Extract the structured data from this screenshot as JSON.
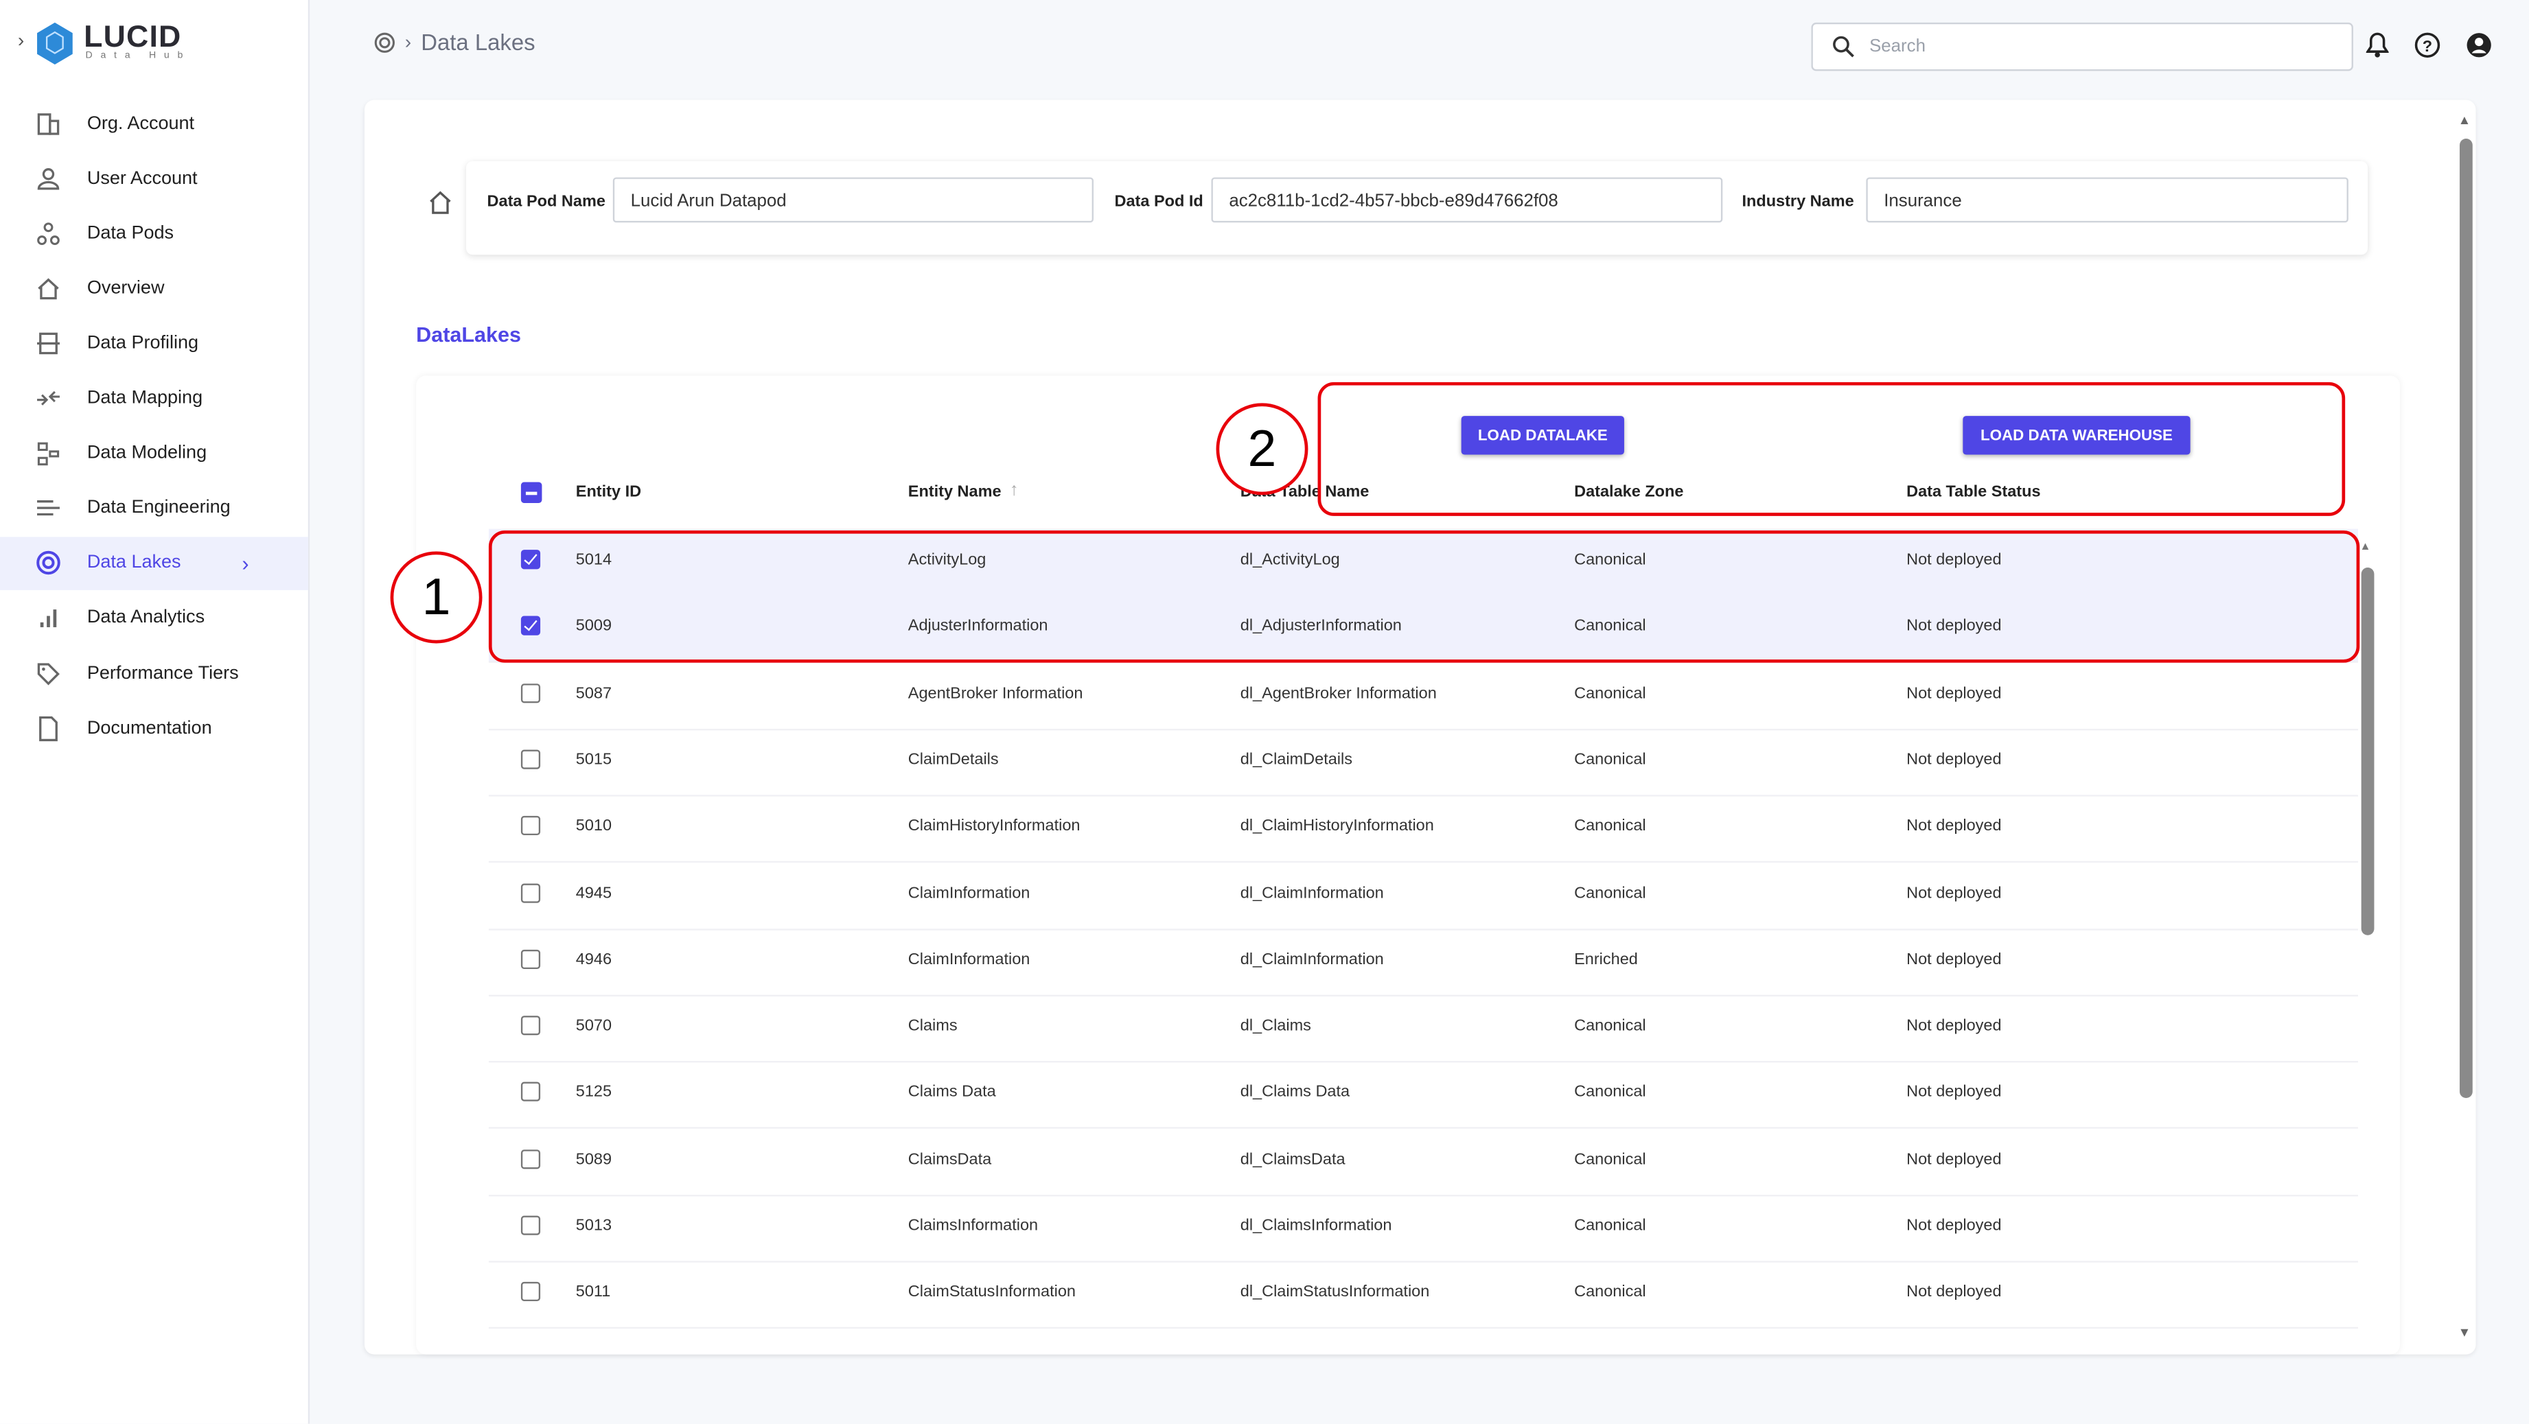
{
  "colors": {
    "accent": "#4f46e5",
    "annotation": "#e8000b"
  },
  "logo": {
    "name": "LUCID",
    "tagline": "Data Hub"
  },
  "sidebar": {
    "items": [
      {
        "label": "Org. Account",
        "icon": "building-icon"
      },
      {
        "label": "User Account",
        "icon": "user-icon"
      },
      {
        "label": "Data Pods",
        "icon": "pods-icon"
      },
      {
        "label": "Overview",
        "icon": "home-icon"
      },
      {
        "label": "Data Profiling",
        "icon": "profiling-icon"
      },
      {
        "label": "Data Mapping",
        "icon": "mapping-icon"
      },
      {
        "label": "Data Modeling",
        "icon": "modeling-icon"
      },
      {
        "label": "Data Engineering",
        "icon": "engineering-icon"
      },
      {
        "label": "Data Lakes",
        "icon": "target-icon",
        "active": true
      },
      {
        "label": "Data Analytics",
        "icon": "bar-chart-icon"
      },
      {
        "label": "Performance Tiers",
        "icon": "tag-icon"
      },
      {
        "label": "Documentation",
        "icon": "document-icon"
      }
    ]
  },
  "header": {
    "breadcrumb": "Data Lakes",
    "search_placeholder": "Search"
  },
  "form": {
    "pod_name_label": "Data Pod Name",
    "pod_name": "Lucid Arun Datapod",
    "pod_id_label": "Data Pod Id",
    "pod_id": "ac2c811b-1cd2-4b57-bbcb-e89d47662f08",
    "industry_label": "Industry Name",
    "industry": "Insurance"
  },
  "section_title": "DataLakes",
  "buttons": {
    "load_datalake": "LOAD DATALAKE",
    "load_warehouse": "LOAD DATA WAREHOUSE"
  },
  "table": {
    "columns": [
      "Entity ID",
      "Entity Name",
      "Data Table Name",
      "Datalake Zone",
      "Data Table Status"
    ],
    "sort": {
      "column": "Entity Name",
      "direction": "ascending"
    },
    "rows": [
      {
        "id": "5014",
        "name": "ActivityLog",
        "table": "dl_ActivityLog",
        "zone": "Canonical",
        "status": "Not deployed",
        "selected": true
      },
      {
        "id": "5009",
        "name": "AdjusterInformation",
        "table": "dl_AdjusterInformation",
        "zone": "Canonical",
        "status": "Not deployed",
        "selected": true
      },
      {
        "id": "5087",
        "name": "AgentBroker Information",
        "table": "dl_AgentBroker Information",
        "zone": "Canonical",
        "status": "Not deployed",
        "selected": false
      },
      {
        "id": "5015",
        "name": "ClaimDetails",
        "table": "dl_ClaimDetails",
        "zone": "Canonical",
        "status": "Not deployed",
        "selected": false
      },
      {
        "id": "5010",
        "name": "ClaimHistoryInformation",
        "table": "dl_ClaimHistoryInformation",
        "zone": "Canonical",
        "status": "Not deployed",
        "selected": false
      },
      {
        "id": "4945",
        "name": "ClaimInformation",
        "table": "dl_ClaimInformation",
        "zone": "Canonical",
        "status": "Not deployed",
        "selected": false
      },
      {
        "id": "4946",
        "name": "ClaimInformation",
        "table": "dl_ClaimInformation",
        "zone": "Enriched",
        "status": "Not deployed",
        "selected": false
      },
      {
        "id": "5070",
        "name": "Claims",
        "table": "dl_Claims",
        "zone": "Canonical",
        "status": "Not deployed",
        "selected": false
      },
      {
        "id": "5125",
        "name": "Claims Data",
        "table": "dl_Claims Data",
        "zone": "Canonical",
        "status": "Not deployed",
        "selected": false
      },
      {
        "id": "5089",
        "name": "ClaimsData",
        "table": "dl_ClaimsData",
        "zone": "Canonical",
        "status": "Not deployed",
        "selected": false
      },
      {
        "id": "5013",
        "name": "ClaimsInformation",
        "table": "dl_ClaimsInformation",
        "zone": "Canonical",
        "status": "Not deployed",
        "selected": false
      },
      {
        "id": "5011",
        "name": "ClaimStatusInformation",
        "table": "dl_ClaimStatusInformation",
        "zone": "Canonical",
        "status": "Not deployed",
        "selected": false
      }
    ]
  },
  "annotations": [
    "1",
    "2"
  ]
}
